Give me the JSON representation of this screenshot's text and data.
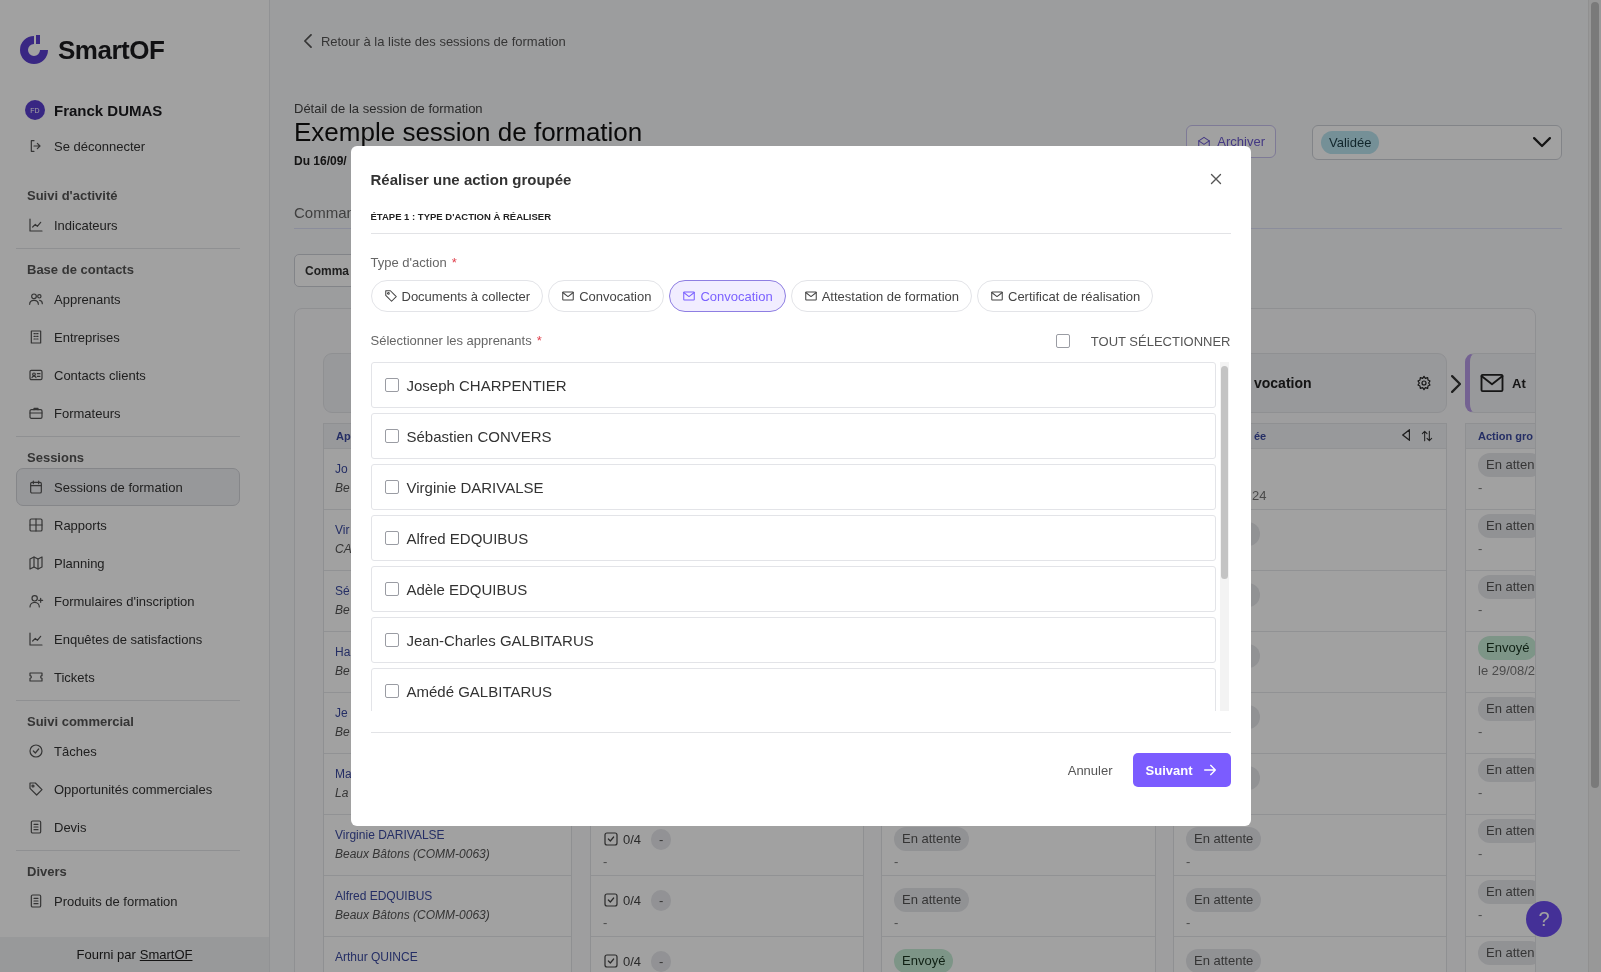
{
  "sidebar": {
    "logo": "SmartOF",
    "user": {
      "initials": "FD",
      "name": "Franck DUMAS"
    },
    "logout": "Se déconnecter",
    "sections": [
      {
        "title": "Suivi d'activité",
        "items": [
          {
            "label": "Indicateurs",
            "selected": false
          }
        ]
      },
      {
        "title": "Base de contacts",
        "items": [
          {
            "label": "Apprenants",
            "selected": false
          },
          {
            "label": "Entreprises",
            "selected": false
          },
          {
            "label": "Contacts clients",
            "selected": false
          },
          {
            "label": "Formateurs",
            "selected": false
          }
        ]
      },
      {
        "title": "Sessions",
        "items": [
          {
            "label": "Sessions de formation",
            "selected": true
          },
          {
            "label": "Rapports",
            "selected": false
          },
          {
            "label": "Planning",
            "selected": false
          },
          {
            "label": "Formulaires d'inscription",
            "selected": false
          },
          {
            "label": "Enquêtes de satisfactions",
            "selected": false
          },
          {
            "label": "Tickets",
            "selected": false
          }
        ]
      },
      {
        "title": "Suivi commercial",
        "items": [
          {
            "label": "Tâches",
            "selected": false
          },
          {
            "label": "Opportunités commerciales",
            "selected": false
          },
          {
            "label": "Devis",
            "selected": false
          }
        ]
      },
      {
        "title": "Divers",
        "items": [
          {
            "label": "Produits de formation",
            "selected": false
          }
        ]
      }
    ],
    "footer": {
      "text": "Fourni par",
      "link": "SmartOF"
    }
  },
  "header": {
    "back_link": "Retour à la liste des sessions de formation",
    "overline": "Détail de la session de formation",
    "title": "Exemple session de formation",
    "dates": "Du 16/09/",
    "archive_button": "Archiver",
    "status": "Validée"
  },
  "tab": "Comman",
  "action_button": "Comma",
  "board": {
    "learners": {
      "header": "Ap",
      "rows": [
        {
          "name": "Jo",
          "company": "Be"
        },
        {
          "name": "Vir",
          "company": "CA"
        },
        {
          "name": "Sé",
          "company": "Be"
        },
        {
          "name": "Ha",
          "company": "Be"
        },
        {
          "name": "Je",
          "company": "Be"
        },
        {
          "name": "Ma",
          "company": "La"
        },
        {
          "name": "Virginie DARIVALSE",
          "company": "Beaux Bâtons (COMM-0063)"
        },
        {
          "name": "Alfred EDQUIBUS",
          "company": "Beaux Bâtons (COMM-0063)"
        },
        {
          "name": "Arthur QUINCE"
        }
      ]
    },
    "documents": {
      "rows": [
        {
          "count": "0/4",
          "badge": "-",
          "note": "-"
        },
        {
          "count": "0/4",
          "badge": "-",
          "note": "-"
        },
        {
          "count": "0/4",
          "badge": "-"
        }
      ]
    },
    "status": {
      "rows": [
        {
          "kind": "pending",
          "status": "En attente",
          "note": "-"
        },
        {
          "kind": "pending",
          "status": "En attente",
          "note": "-"
        },
        {
          "kind": "sent",
          "status": "Envoyé"
        }
      ]
    },
    "convocation": {
      "title": "vocation",
      "subheader": "ée",
      "rows": [
        {
          "note": "24"
        },
        {
          "kind": "pending"
        },
        {
          "kind": "pending"
        },
        {
          "kind": "pending"
        },
        {
          "kind": "pending"
        },
        {
          "kind": "pending"
        },
        {
          "kind": "pending",
          "status": "En attente",
          "note": "-"
        },
        {
          "kind": "pending",
          "status": "En attente",
          "note": "-"
        },
        {
          "kind": "pending",
          "status": "En attente"
        }
      ]
    },
    "attestation": {
      "title": "At",
      "subheader": "Action gro",
      "rows": [
        {
          "kind": "pending",
          "status": "En atten",
          "note": "-"
        },
        {
          "kind": "pending",
          "status": "En atten",
          "note": "-"
        },
        {
          "kind": "pending",
          "status": "En atten",
          "note": "-"
        },
        {
          "kind": "sent",
          "status": "Envoyé",
          "note": "le 29/08/2"
        },
        {
          "kind": "pending",
          "status": "En atten",
          "note": "-"
        },
        {
          "kind": "pending",
          "status": "En atten",
          "note": "-"
        },
        {
          "kind": "pending",
          "status": "En atten",
          "note": "-"
        },
        {
          "kind": "pending",
          "status": "En atten",
          "note": "-"
        },
        {
          "kind": "pending",
          "status": "En atten"
        }
      ]
    }
  },
  "help_button": "?",
  "dialog": {
    "title": "Réaliser une action groupée",
    "step": "ÉTAPE 1 : TYPE D'ACTION À RÉALISER",
    "type_field": {
      "label": "Type d'action",
      "required": "*"
    },
    "action_types": [
      {
        "label": "Documents à collecter",
        "selected": false
      },
      {
        "label": "Convocation",
        "selected": false
      },
      {
        "label": "Convocation",
        "selected": true
      },
      {
        "label": "Attestation de formation",
        "selected": false
      },
      {
        "label": "Certificat de réalisation",
        "selected": false
      }
    ],
    "learners_field": {
      "label": "Sélectionner les apprenants",
      "required": "*"
    },
    "select_all": {
      "label": "TOUT SÉLECTIONNER",
      "checked": false
    },
    "learners": [
      {
        "name": "Joseph CHARPENTIER",
        "checked": false
      },
      {
        "name": "Sébastien CONVERS",
        "checked": false
      },
      {
        "name": "Virginie DARIVALSE",
        "checked": false
      },
      {
        "name": "Alfred EDQUIBUS",
        "checked": false
      },
      {
        "name": "Adèle EDQUIBUS",
        "checked": false
      },
      {
        "name": "Jean-Charles GALBITARUS",
        "checked": false
      },
      {
        "name": "Amédé GALBITARUS",
        "checked": false
      }
    ],
    "cancel": "Annuler",
    "next": "Suivant"
  }
}
